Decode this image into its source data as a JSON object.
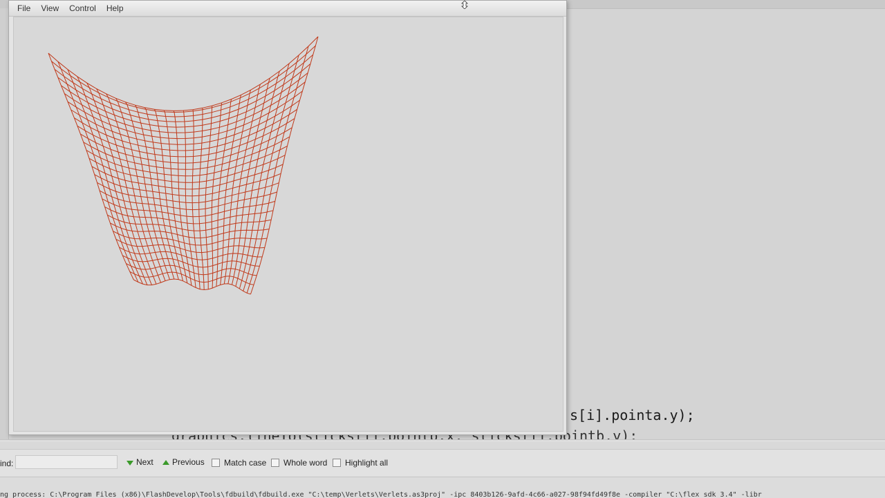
{
  "player": {
    "menu": [
      "File",
      "View",
      "Control",
      "Help"
    ]
  },
  "editor": {
    "code_line_1": "s[i].pointa.y);",
    "code_line_2": "graphics.lineTo(sticks[i].pointb.x, sticks[i].pointb.y);"
  },
  "findbar": {
    "label": "ind:",
    "input_value": "",
    "next_label": "Next",
    "previous_label": "Previous",
    "match_case_label": "Match case",
    "whole_word_label": "Whole word",
    "highlight_all_label": "Highlight all"
  },
  "output": {
    "text": "ng process: C:\\Program Files (x86)\\FlashDevelop\\Tools\\fdbuild\\fdbuild.exe \"C:\\temp\\Verlets\\Verlets.as3proj\" -ipc 8403b126-9afd-4c66-a027-98f94fd49f8e -compiler \"C:\\flex_sdk_3.4\" -libr"
  },
  "colors": {
    "cloth": "#c0391a",
    "accent_green": "#3a9a2a"
  }
}
